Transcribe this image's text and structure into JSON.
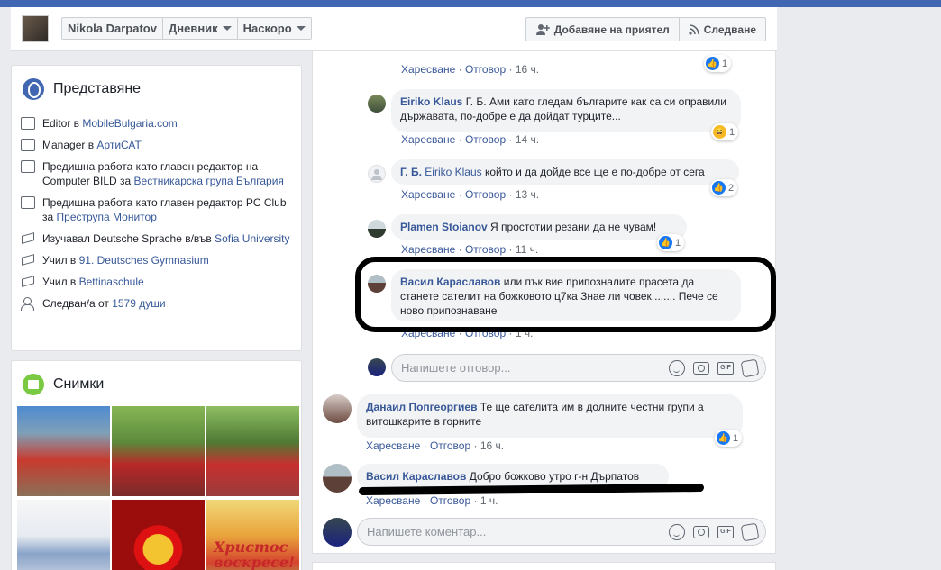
{
  "header": {
    "profile_name": "Nikola Darpatov",
    "crumbs": [
      "Дневник",
      "Наскоро"
    ],
    "add_friend": "Добавяне на приятел",
    "follow": "Следване"
  },
  "intro": {
    "title": "Представяне",
    "items": [
      {
        "pre": "Editor в ",
        "link": "MobileBulgaria.com",
        "post": ""
      },
      {
        "pre": "Manager в ",
        "link": "АртиСАТ",
        "post": ""
      },
      {
        "pre": "Предишна работа като главен редактор на Computer BILD за ",
        "link": "Вестникарска група България",
        "post": ""
      },
      {
        "pre": "Предишна работа като главен редактор PC Club за ",
        "link": "Преструпа Монитор",
        "post": ""
      },
      {
        "pre": "Изучавал Deutsche Sprache в/във ",
        "link": "Sofia University",
        "post": ""
      },
      {
        "pre": "Учил в ",
        "link": "91. Deutsches Gymnasium",
        "post": ""
      },
      {
        "pre": "Учил в ",
        "link": "Bettinaschule",
        "post": ""
      },
      {
        "pre": "Следван/а от ",
        "link": "1579 души",
        "post": ""
      }
    ]
  },
  "photos": {
    "title": "Снимки",
    "items": [
      "Христос воскресе!"
    ]
  },
  "labels": {
    "like": "Харесване",
    "reply": "Отговор",
    "sep": "·"
  },
  "comments": [
    {
      "name": "",
      "text": "",
      "time": "16 ч.",
      "react_count": "1"
    },
    {
      "name": "Eiriko Klaus",
      "text": "Г. Б. Ами като гледам българите как са си оправили държавата, по-добре е да дойдат турците...",
      "time": "14 ч.",
      "react_count": "1"
    },
    {
      "name": "Г. Б.",
      "link_name": "Eiriko Klaus",
      "text": "който и да дойде все ще е по-добре от сега",
      "time": "13 ч.",
      "react_count": "2"
    },
    {
      "name": "Plamen Stoianov",
      "text": "Я простотии резани да не чувам!",
      "time": "11 ч.",
      "react_count": "1"
    },
    {
      "name": "Васил Караславов",
      "text": "или пък вие припозналите прасета да станете сателит на божковото ц7ка Знае ли човек........ Пече се ново припознаване",
      "time": "1 ч."
    },
    {
      "name": "Данаил Попгеоргиев",
      "text": "Те ще сателита им в долните честни групи а витошкарите в горните",
      "time": "16 ч.",
      "react_count": "1"
    },
    {
      "name": "Васил Караславов",
      "text": "Добро божково утро г-н Дърпатов",
      "time": "1 ч."
    }
  ],
  "inputs": {
    "reply_placeholder": "Напишете отговор...",
    "comment_placeholder": "Напишете коментар..."
  },
  "tools": {
    "gif": "GIF"
  }
}
